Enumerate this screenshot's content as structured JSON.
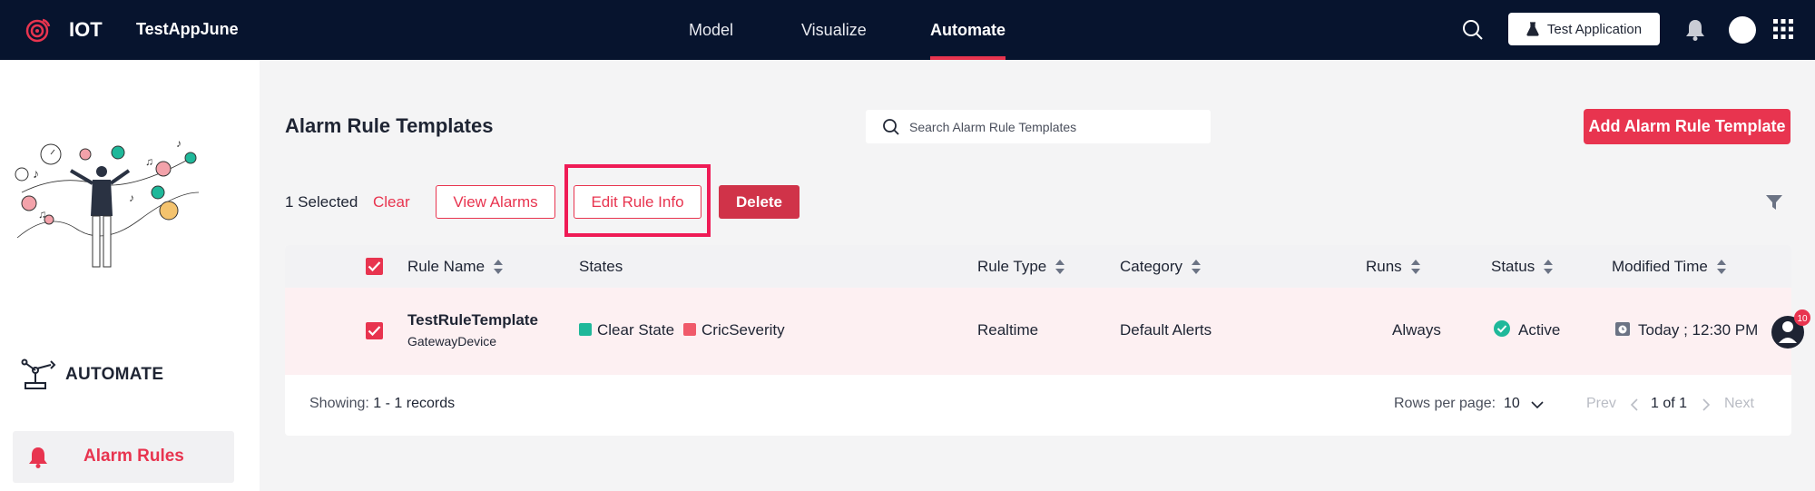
{
  "topbar": {
    "brand": "IOT",
    "app_name": "TestAppJune",
    "nav": [
      {
        "label": "Model"
      },
      {
        "label": "Visualize"
      },
      {
        "label": "Automate",
        "active": true
      }
    ],
    "test_app_button": "Test Application",
    "icons": [
      "search-icon",
      "flask-icon",
      "bell-icon",
      "avatar",
      "apps-grid-icon"
    ]
  },
  "sidebar": {
    "section_title": "AUTOMATE",
    "items": [
      {
        "label": "Alarm Rules",
        "icon": "bell-icon",
        "active": true
      }
    ]
  },
  "main": {
    "title": "Alarm Rule Templates",
    "search_placeholder": "Search Alarm Rule Templates",
    "add_button": "Add Alarm Rule Template",
    "selection": {
      "selected_text": "1 Selected",
      "clear": "Clear",
      "view_alarms": "View Alarms",
      "edit_rule_info": "Edit Rule Info",
      "delete": "Delete"
    },
    "table": {
      "columns": [
        "Rule Name",
        "States",
        "Rule Type",
        "Category",
        "Runs",
        "Status",
        "Modified Time"
      ],
      "rows": [
        {
          "checked": true,
          "rule_name": "TestRuleTemplate",
          "asset": "GatewayDevice",
          "states": [
            {
              "label": "Clear State",
              "color": "#1fb89a"
            },
            {
              "label": "CricSeverity",
              "color": "#f05a6a"
            }
          ],
          "rule_type": "Realtime",
          "category": "Default Alerts",
          "runs": "Always",
          "status": "Active",
          "modified_time": "Today ; 12:30 PM"
        }
      ]
    },
    "footer": {
      "showing_label": "Showing:",
      "showing_value": "1 - 1 records",
      "rows_per_page_label": "Rows per page:",
      "rows_per_page_value": "10",
      "prev": "Prev",
      "page_info": "1 of 1",
      "next": "Next"
    },
    "help_badge_count": "10"
  },
  "colors": {
    "topbar": "#07142e",
    "accent": "#e8344f",
    "highlight": "#ef1b56",
    "row_selected": "#fdf0f2",
    "status_active": "#1fb89a"
  }
}
